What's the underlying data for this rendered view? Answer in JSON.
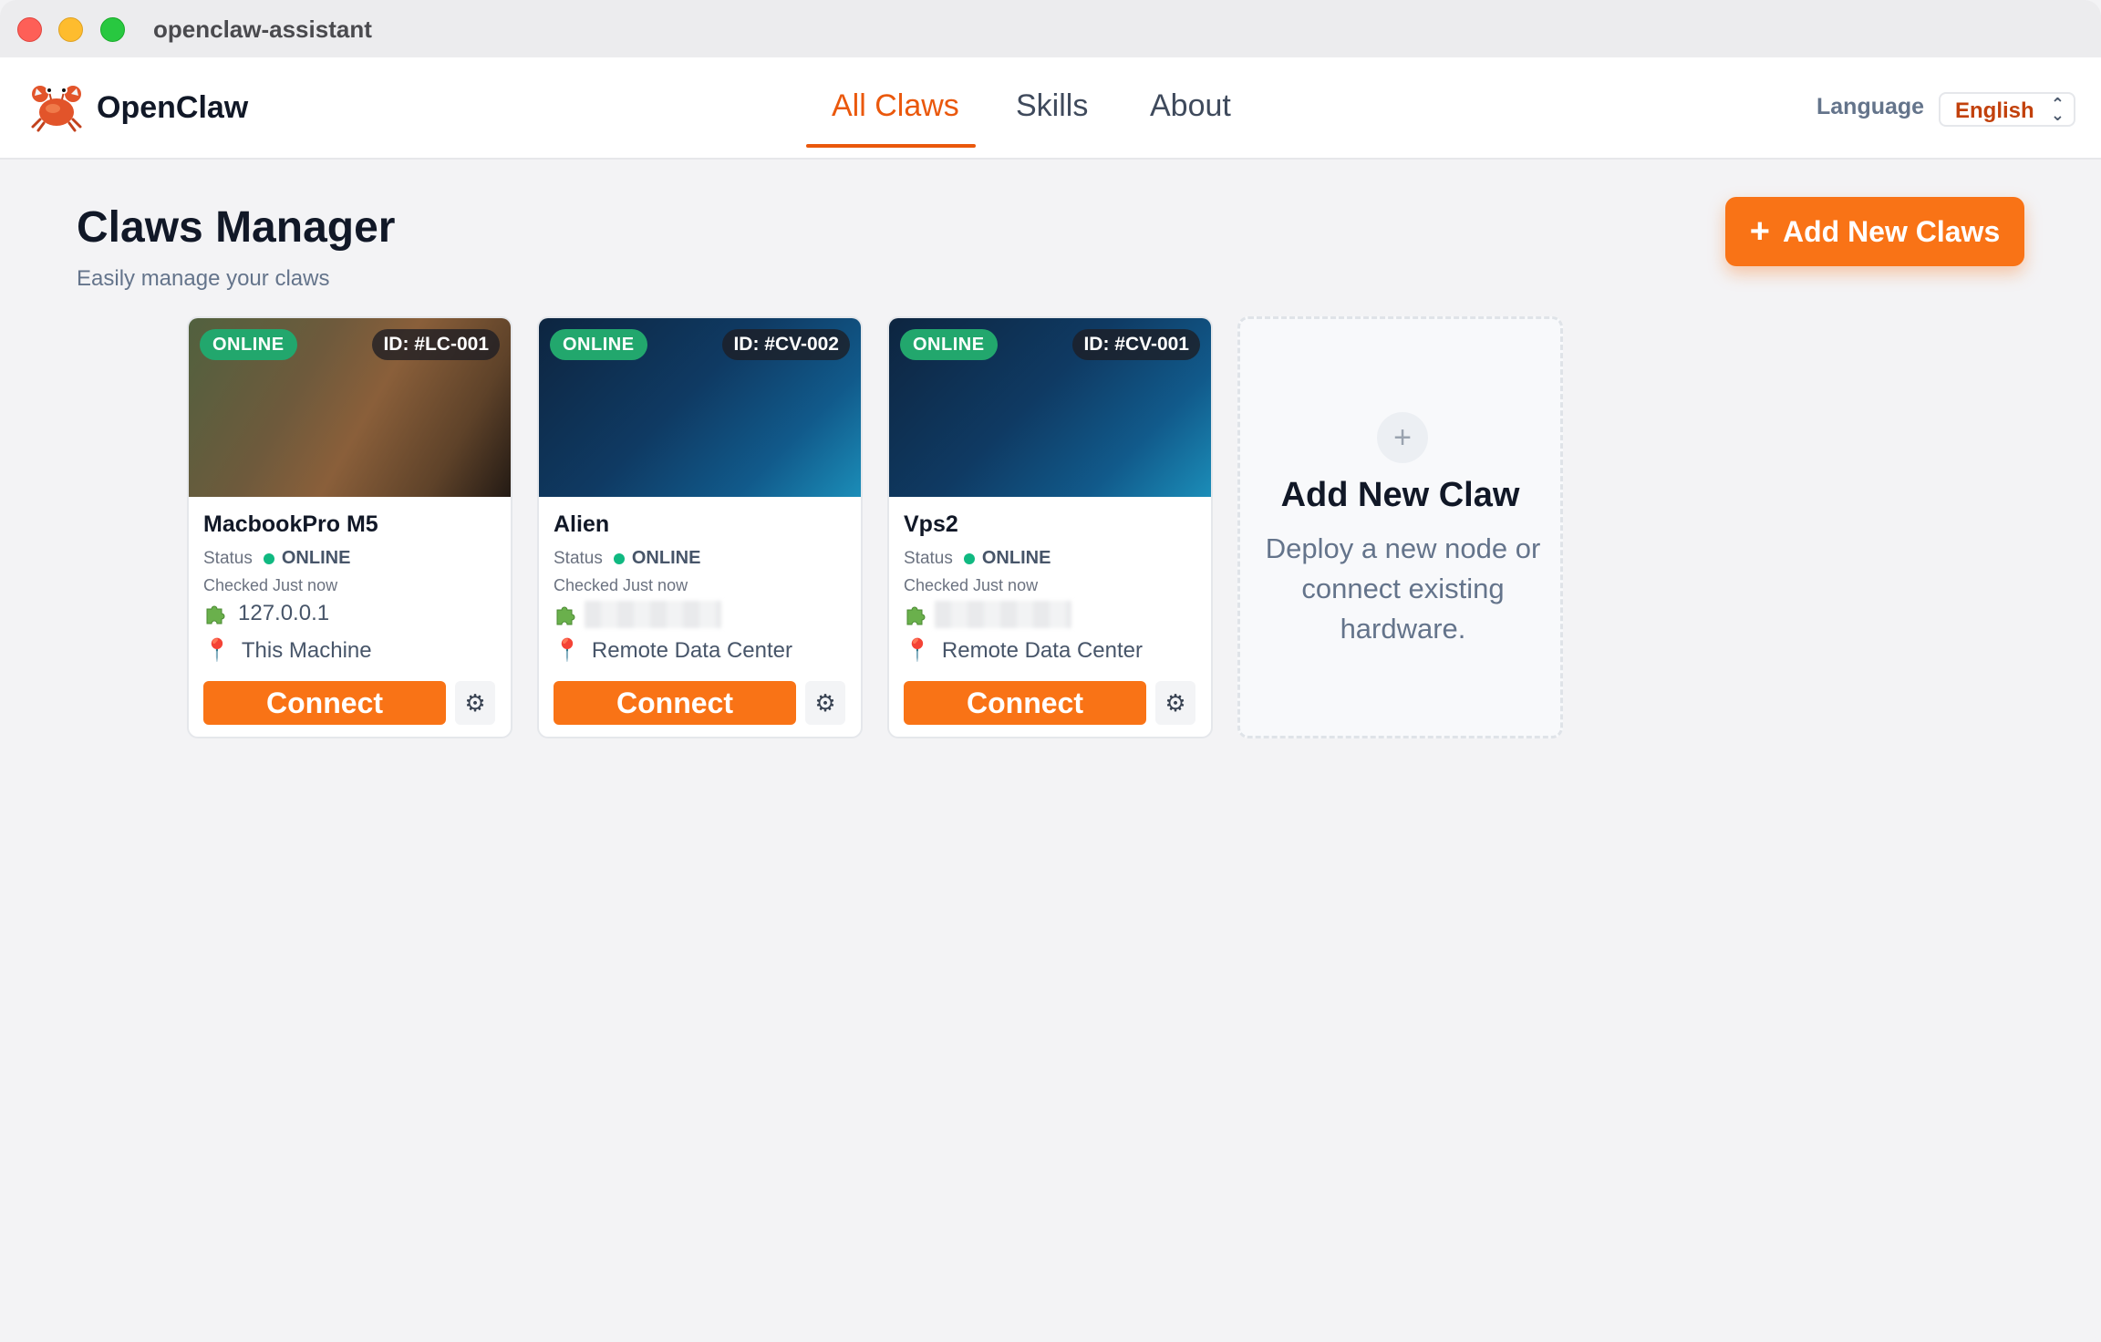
{
  "window": {
    "title": "openclaw-assistant"
  },
  "header": {
    "brand": "OpenClaw",
    "nav": [
      {
        "label": "All Claws",
        "active": true
      },
      {
        "label": "Skills",
        "active": false
      },
      {
        "label": "About",
        "active": false
      }
    ],
    "language_label": "Language",
    "language_value": "English"
  },
  "page": {
    "title": "Claws Manager",
    "subtitle": "Easily manage your claws",
    "add_button": "Add New Claws",
    "add_button_icon": "+"
  },
  "claws": [
    {
      "status_badge": "ONLINE",
      "id": "ID: #LC-001",
      "name": "MacbookPro M5",
      "status_label": "Status",
      "status": "ONLINE",
      "checked": "Checked Just now",
      "ip": "127.0.0.1",
      "location": "This Machine",
      "connect": "Connect",
      "banner": "brown"
    },
    {
      "status_badge": "ONLINE",
      "id": "ID: #CV-002",
      "name": "Alien",
      "status_label": "Status",
      "status": "ONLINE",
      "checked": "Checked Just now",
      "ip": "",
      "location": "Remote Data Center",
      "connect": "Connect",
      "banner": "blue"
    },
    {
      "status_badge": "ONLINE",
      "id": "ID: #CV-001",
      "name": "Vps2",
      "status_label": "Status",
      "status": "ONLINE",
      "checked": "Checked Just now",
      "ip": "",
      "location": "Remote Data Center",
      "connect": "Connect",
      "banner": "blue"
    }
  ],
  "add_card": {
    "icon": "+",
    "title": "Add New Claw",
    "description": "Deploy a new node or connect existing hardware."
  },
  "colors": {
    "accent": "#f97316",
    "online": "#22a76d",
    "active_tab": "#ea580c"
  },
  "icons": {
    "logo": "crab-icon",
    "ip": "puzzle-icon",
    "location": "pin-icon",
    "settings": "gear-icon"
  }
}
